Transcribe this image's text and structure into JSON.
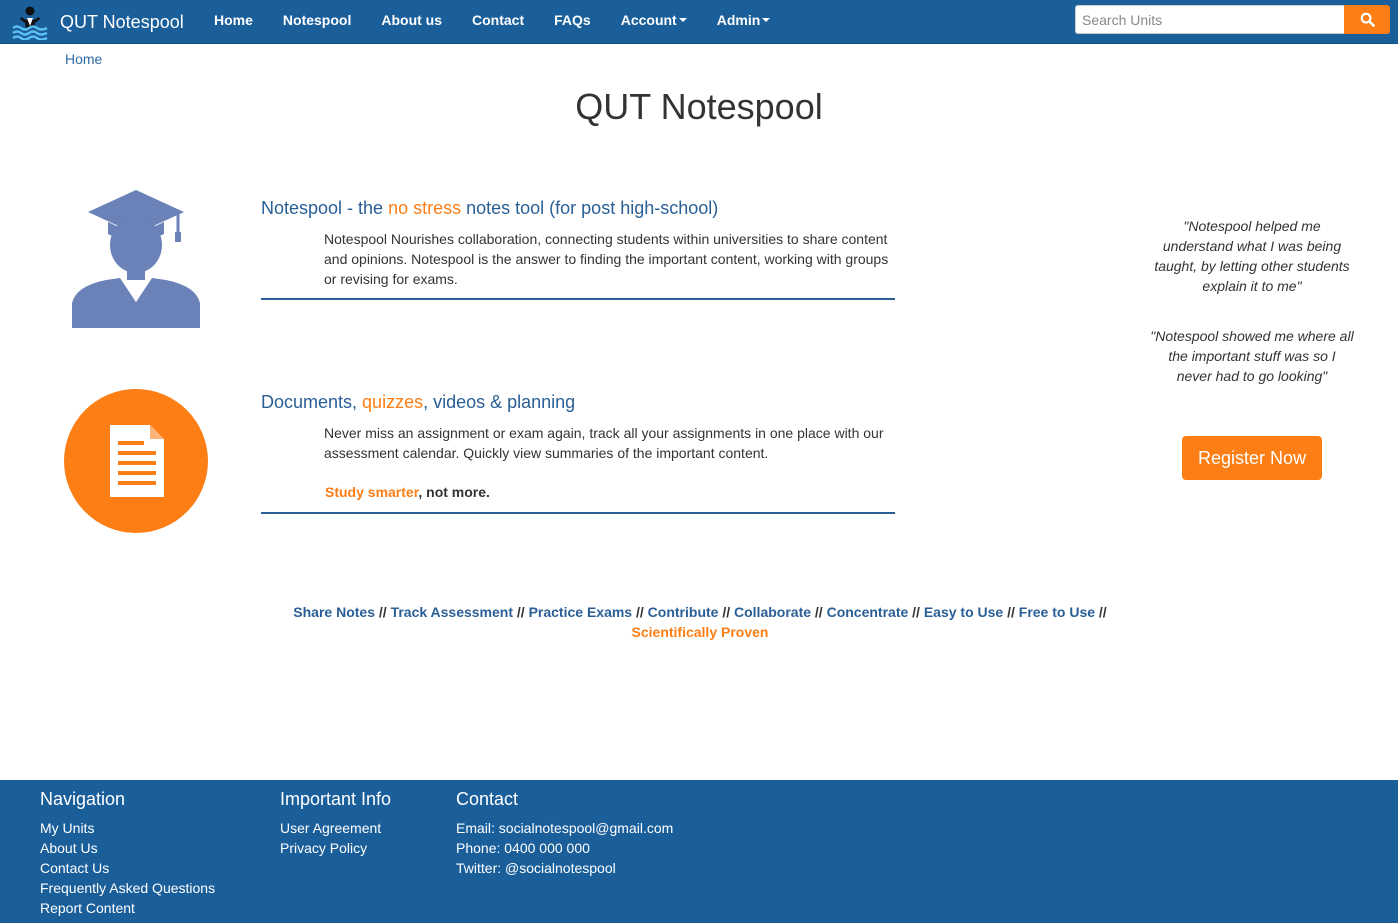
{
  "colors": {
    "nav": "#1a5e9a",
    "accent": "#fd7e14",
    "heading_blue": "#2a5f96",
    "icon_grad": "#6a82b8"
  },
  "brand": {
    "name": "QUT Notespool",
    "logo_icon": "swimmer-wave-logo-icon"
  },
  "nav": {
    "items": [
      {
        "label": "Home",
        "dropdown": false
      },
      {
        "label": "Notespool",
        "dropdown": false
      },
      {
        "label": "About us",
        "dropdown": false
      },
      {
        "label": "Contact",
        "dropdown": false
      },
      {
        "label": "FAQs",
        "dropdown": false
      },
      {
        "label": "Account",
        "dropdown": true
      },
      {
        "label": "Admin",
        "dropdown": true
      }
    ]
  },
  "search": {
    "placeholder": "Search Units",
    "value": "",
    "button_icon": "search-icon"
  },
  "breadcrumb": {
    "home": "Home"
  },
  "page": {
    "title": "QUT Notespool"
  },
  "features": [
    {
      "icon": "graduate-icon",
      "heading_parts": [
        "Notespool - the ",
        "no stress",
        " notes tool (for post high-school)"
      ],
      "text": "Notespool Nourishes collaboration, connecting students within universities to share content and opinions. Notespool is the answer to finding the important content, working with groups or revising for exams."
    },
    {
      "icon": "document-icon",
      "heading_parts": [
        "Documents, ",
        "quizzes",
        ", videos & planning"
      ],
      "text": "Never miss an assignment or exam again, track all your assignments in one place with our assessment calendar. Quickly view summaries of the important content.",
      "study_orange": "Study smarter",
      "study_rest": ", not more."
    }
  ],
  "testimonials": [
    "\"Notespool helped me understand what I was being taught, by letting other students explain it to me\"",
    "\"Notespool showed me where all the important stuff was so I never had to go looking\""
  ],
  "register": {
    "label": "Register Now"
  },
  "tagline": {
    "items": [
      "Share Notes",
      "Track Assessment",
      "Practice Exams",
      "Contribute",
      "Collaborate",
      "Concentrate",
      "Easy to Use",
      "Free to Use"
    ],
    "separator": " // ",
    "last": "Scientifically Proven"
  },
  "footer": {
    "navigation": {
      "title": "Navigation",
      "links": [
        "My Units",
        "About Us",
        "Contact Us",
        "Frequently Asked Questions",
        "Report Content"
      ]
    },
    "info": {
      "title": "Important Info",
      "links": [
        "User Agreement",
        "Privacy Policy"
      ]
    },
    "contact": {
      "title": "Contact",
      "lines": [
        "Email: socialnotespool@gmail.com",
        "Phone: 0400 000 000",
        "Twitter: @socialnotespool"
      ]
    }
  }
}
